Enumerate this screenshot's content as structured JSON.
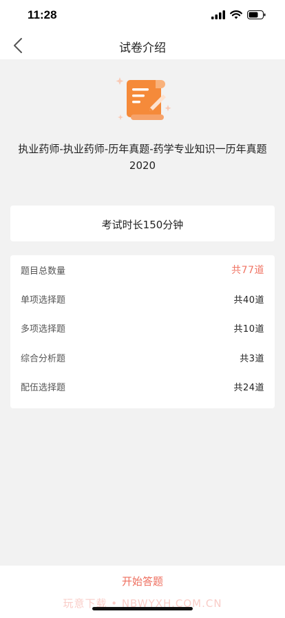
{
  "status_bar": {
    "time": "11:28"
  },
  "nav": {
    "title": "试卷介绍"
  },
  "exam": {
    "title_line1": "执业药师-执业药师-历年真题-药学专业知识一历年真题",
    "title_line2": "2020",
    "duration": "考试时长150分钟"
  },
  "stats": [
    {
      "label": "题目总数量",
      "value": "共77道",
      "accent": "#f07363"
    },
    {
      "label": "单项选择题",
      "value": "共40道"
    },
    {
      "label": "多项选择题",
      "value": "共10道"
    },
    {
      "label": "综合分析题",
      "value": "共3道"
    },
    {
      "label": "配伍选择题",
      "value": "共24道"
    }
  ],
  "bottom": {
    "start_label": "开始答题",
    "watermark": "玩意下载 • NBWYXH.COM.CN"
  },
  "colors": {
    "accent": "#f07363",
    "icon_orange": "#f58a3a",
    "background": "#f2f2f2"
  },
  "icons": [
    "back-chevron-icon",
    "signal-icon",
    "wifi-icon",
    "battery-icon",
    "exam-scroll-icon"
  ]
}
